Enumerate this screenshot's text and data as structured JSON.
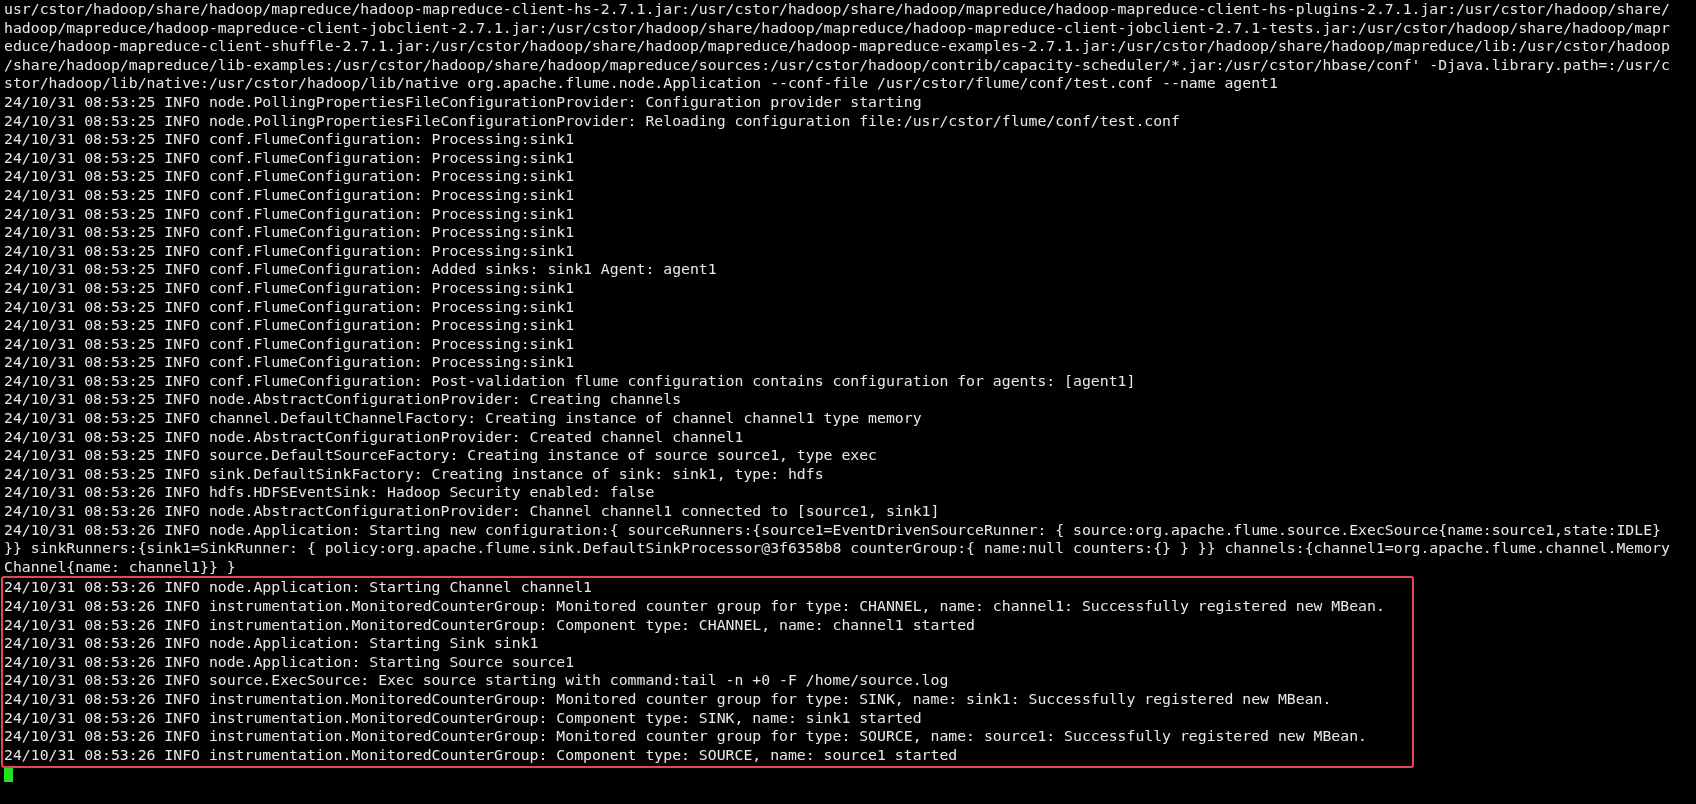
{
  "output": [
    "usr/cstor/hadoop/share/hadoop/mapreduce/hadoop-mapreduce-client-hs-2.7.1.jar:/usr/cstor/hadoop/share/hadoop/mapreduce/hadoop-mapreduce-client-hs-plugins-2.7.1.jar:/usr/cstor/hadoop/share/",
    "hadoop/mapreduce/hadoop-mapreduce-client-jobclient-2.7.1.jar:/usr/cstor/hadoop/share/hadoop/mapreduce/hadoop-mapreduce-client-jobclient-2.7.1-tests.jar:/usr/cstor/hadoop/share/hadoop/mapr",
    "educe/hadoop-mapreduce-client-shuffle-2.7.1.jar:/usr/cstor/hadoop/share/hadoop/mapreduce/hadoop-mapreduce-examples-2.7.1.jar:/usr/cstor/hadoop/share/hadoop/mapreduce/lib:/usr/cstor/hadoop",
    "/share/hadoop/mapreduce/lib-examples:/usr/cstor/hadoop/share/hadoop/mapreduce/sources:/usr/cstor/hadoop/contrib/capacity-scheduler/*.jar:/usr/cstor/hbase/conf' -Djava.library.path=:/usr/c",
    "stor/hadoop/lib/native:/usr/cstor/hadoop/lib/native org.apache.flume.node.Application --conf-file /usr/cstor/flume/conf/test.conf --name agent1",
    "24/10/31 08:53:25 INFO node.PollingPropertiesFileConfigurationProvider: Configuration provider starting",
    "24/10/31 08:53:25 INFO node.PollingPropertiesFileConfigurationProvider: Reloading configuration file:/usr/cstor/flume/conf/test.conf",
    "24/10/31 08:53:25 INFO conf.FlumeConfiguration: Processing:sink1",
    "24/10/31 08:53:25 INFO conf.FlumeConfiguration: Processing:sink1",
    "24/10/31 08:53:25 INFO conf.FlumeConfiguration: Processing:sink1",
    "24/10/31 08:53:25 INFO conf.FlumeConfiguration: Processing:sink1",
    "24/10/31 08:53:25 INFO conf.FlumeConfiguration: Processing:sink1",
    "24/10/31 08:53:25 INFO conf.FlumeConfiguration: Processing:sink1",
    "24/10/31 08:53:25 INFO conf.FlumeConfiguration: Processing:sink1",
    "24/10/31 08:53:25 INFO conf.FlumeConfiguration: Added sinks: sink1 Agent: agent1",
    "24/10/31 08:53:25 INFO conf.FlumeConfiguration: Processing:sink1",
    "24/10/31 08:53:25 INFO conf.FlumeConfiguration: Processing:sink1",
    "24/10/31 08:53:25 INFO conf.FlumeConfiguration: Processing:sink1",
    "24/10/31 08:53:25 INFO conf.FlumeConfiguration: Processing:sink1",
    "24/10/31 08:53:25 INFO conf.FlumeConfiguration: Processing:sink1",
    "24/10/31 08:53:25 INFO conf.FlumeConfiguration: Post-validation flume configuration contains configuration for agents: [agent1]",
    "24/10/31 08:53:25 INFO node.AbstractConfigurationProvider: Creating channels",
    "24/10/31 08:53:25 INFO channel.DefaultChannelFactory: Creating instance of channel channel1 type memory",
    "24/10/31 08:53:25 INFO node.AbstractConfigurationProvider: Created channel channel1",
    "24/10/31 08:53:25 INFO source.DefaultSourceFactory: Creating instance of source source1, type exec",
    "24/10/31 08:53:25 INFO sink.DefaultSinkFactory: Creating instance of sink: sink1, type: hdfs",
    "24/10/31 08:53:26 INFO hdfs.HDFSEventSink: Hadoop Security enabled: false",
    "24/10/31 08:53:26 INFO node.AbstractConfigurationProvider: Channel channel1 connected to [source1, sink1]",
    "24/10/31 08:53:26 INFO node.Application: Starting new configuration:{ sourceRunners:{source1=EventDrivenSourceRunner: { source:org.apache.flume.source.ExecSource{name:source1,state:IDLE}",
    "}} sinkRunners:{sink1=SinkRunner: { policy:org.apache.flume.sink.DefaultSinkProcessor@3f6358b8 counterGroup:{ name:null counters:{} } }} channels:{channel1=org.apache.flume.channel.Memory",
    "Channel{name: channel1}} }"
  ],
  "highlighted_output": [
    "24/10/31 08:53:26 INFO node.Application: Starting Channel channel1",
    "24/10/31 08:53:26 INFO instrumentation.MonitoredCounterGroup: Monitored counter group for type: CHANNEL, name: channel1: Successfully registered new MBean.",
    "24/10/31 08:53:26 INFO instrumentation.MonitoredCounterGroup: Component type: CHANNEL, name: channel1 started",
    "24/10/31 08:53:26 INFO node.Application: Starting Sink sink1",
    "24/10/31 08:53:26 INFO node.Application: Starting Source source1",
    "24/10/31 08:53:26 INFO source.ExecSource: Exec source starting with command:tail -n +0 -F /home/source.log",
    "24/10/31 08:53:26 INFO instrumentation.MonitoredCounterGroup: Monitored counter group for type: SINK, name: sink1: Successfully registered new MBean.",
    "24/10/31 08:53:26 INFO instrumentation.MonitoredCounterGroup: Component type: SINK, name: sink1 started",
    "24/10/31 08:53:26 INFO instrumentation.MonitoredCounterGroup: Monitored counter group for type: SOURCE, name: source1: Successfully registered new MBean.",
    "24/10/31 08:53:26 INFO instrumentation.MonitoredCounterGroup: Component type: SOURCE, name: source1 started"
  ]
}
